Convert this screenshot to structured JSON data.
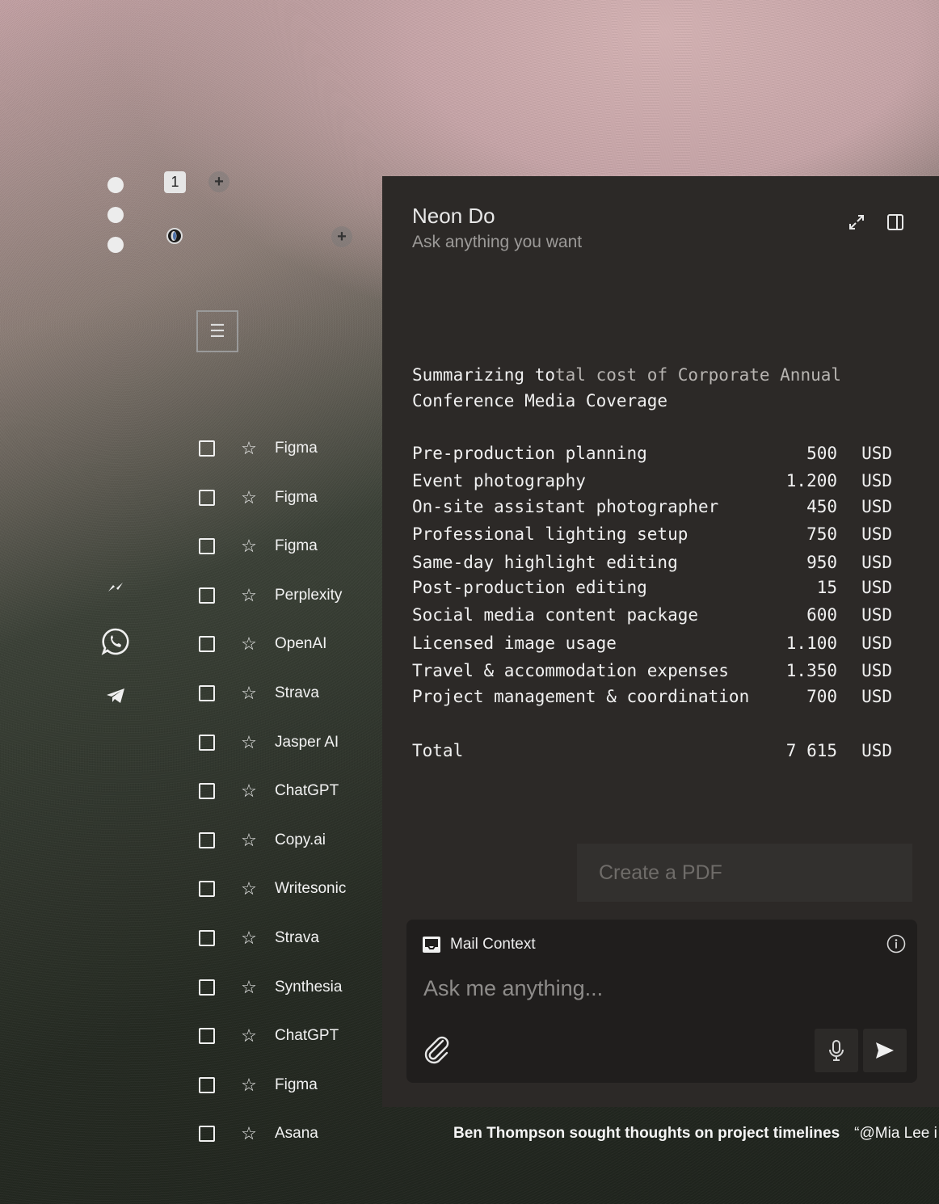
{
  "tab_strip": {
    "tab_number": "1"
  },
  "panel": {
    "title": "Neon Do",
    "subtitle": "Ask anything you want",
    "summary_line1_bright": "Summarizing to",
    "summary_line1_dim": "tal cost of Corporate Annual",
    "summary_line2": "Conference Media Coverage",
    "costs": [
      {
        "label": "Pre-production planning",
        "amount": "500",
        "currency": "USD"
      },
      {
        "label": "Event photography",
        "amount": "1.200",
        "currency": "USD"
      },
      {
        "label": "On-site assistant photographer",
        "amount": "450",
        "currency": "USD"
      },
      {
        "label": "Professional lighting setup",
        "amount": "750",
        "currency": "USD"
      },
      {
        "label": "Same-day highlight editing",
        "amount": "950",
        "currency": "USD"
      },
      {
        "label": "Post-production editing",
        "amount": "15",
        "currency": "USD"
      },
      {
        "label": "Social media content package",
        "amount": "600",
        "currency": "USD"
      },
      {
        "label": "Licensed image usage",
        "amount": "1.100",
        "currency": "USD"
      },
      {
        "label": "Travel & accommodation expenses",
        "amount": "1.350",
        "currency": "USD"
      },
      {
        "label": "Project management & coordination",
        "amount": "700",
        "currency": "USD"
      }
    ],
    "total": {
      "label": "Total",
      "amount": "7 615",
      "currency": "USD"
    },
    "pdf_button": "Create a PDF",
    "composer": {
      "context_label": "Mail Context",
      "placeholder": "Ask me anything..."
    }
  },
  "list_items": [
    "Figma",
    "Figma",
    "Figma",
    "Perplexity",
    "OpenAI",
    "Strava",
    "Jasper AI",
    "ChatGPT",
    "Copy.ai",
    "Writesonic",
    "Strava",
    "Synthesia",
    "ChatGPT",
    "Figma",
    "Asana"
  ],
  "ticker": {
    "headline": "Ben Thompson sought thoughts on project timelines",
    "next": "“@Mia Lee i"
  },
  "icons": {
    "window_dots": "traffic-light-dots",
    "left_apps": [
      "messenger-icon",
      "whatsapp-icon",
      "telegram-icon"
    ]
  }
}
